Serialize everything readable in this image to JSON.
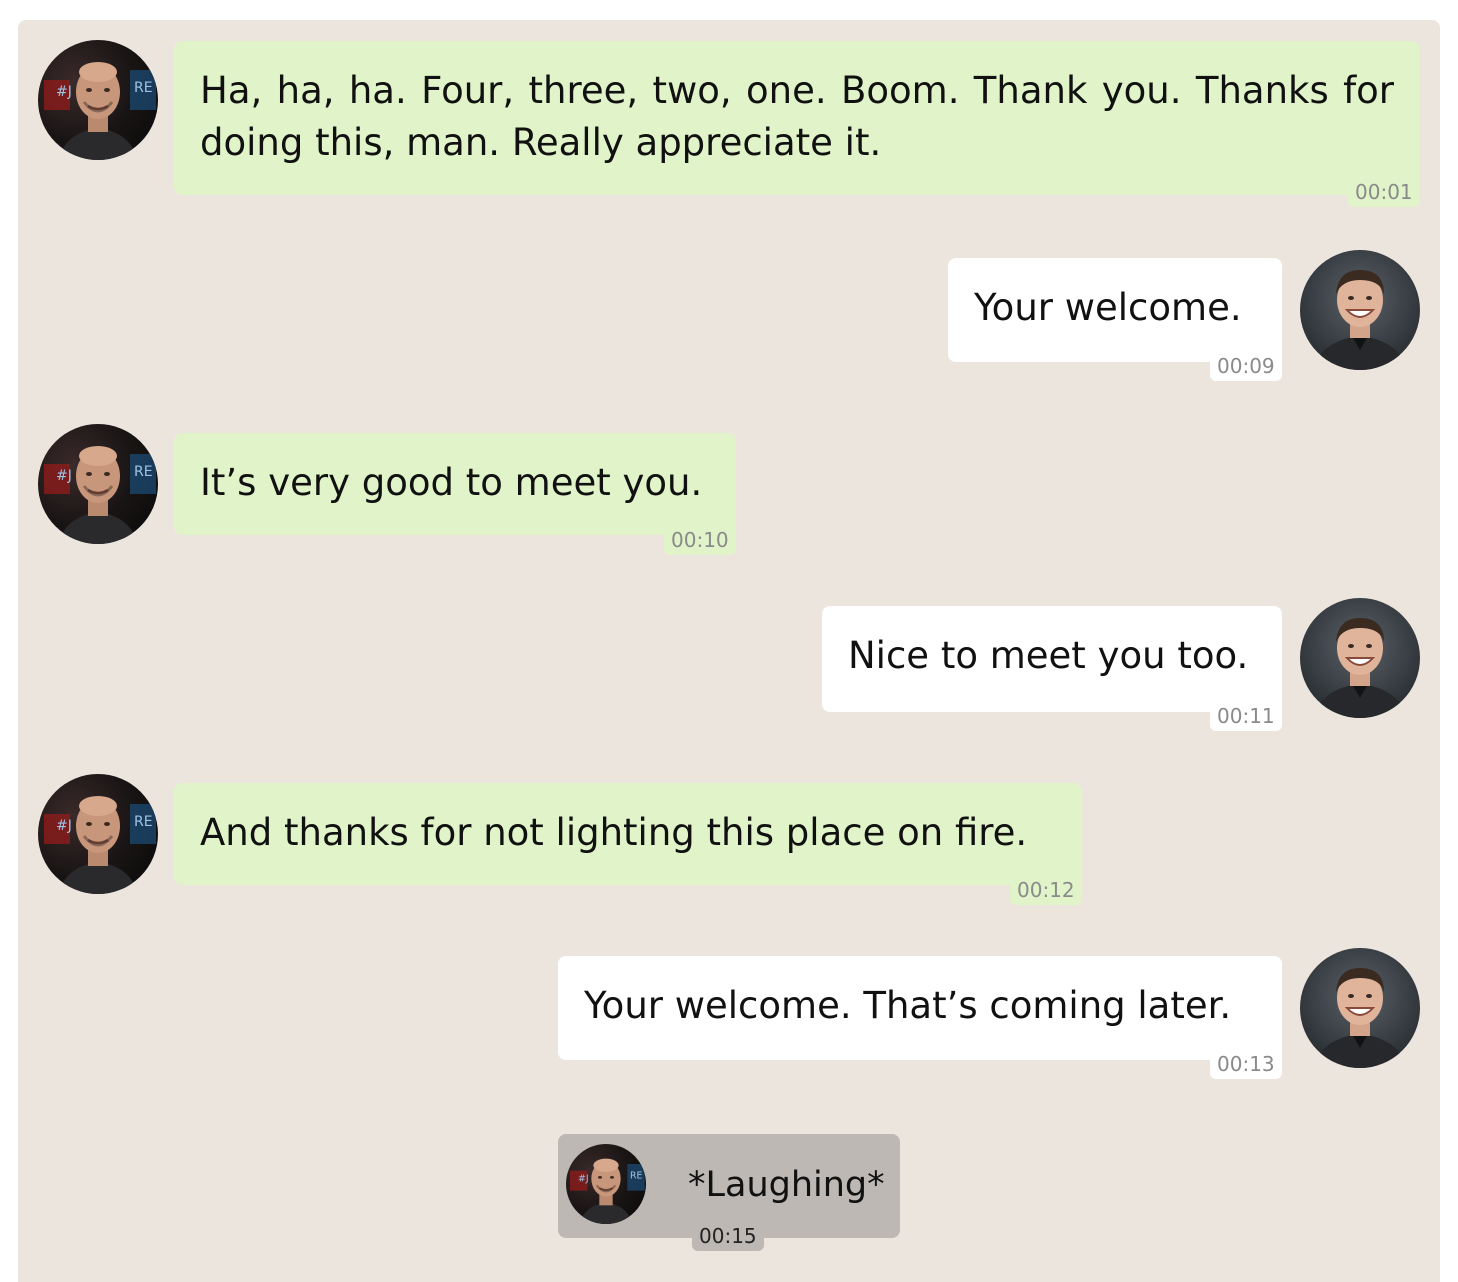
{
  "colors": {
    "chat_background": "#ece5de",
    "left_bubble": "#e1f4c9",
    "right_bubble": "#ffffff",
    "system_bubble": "#bdb8b3",
    "timestamp_text": "#8a8a8a"
  },
  "participants": {
    "host": {
      "avatar_icon": "host-avatar-photo",
      "side": "left"
    },
    "guest": {
      "avatar_icon": "guest-avatar-photo",
      "side": "right"
    }
  },
  "messages": [
    {
      "speaker": "host",
      "text": "Ha, ha, ha. Four, three, two, one. Boom. Thank you. Thanks for doing this, man. Really appreciate it.",
      "time": "00:01"
    },
    {
      "speaker": "guest",
      "text": "Your welcome.",
      "time": "00:09"
    },
    {
      "speaker": "host",
      "text": "It’s very good to meet you.",
      "time": "00:10"
    },
    {
      "speaker": "guest",
      "text": "Nice to meet you too.",
      "time": "00:11"
    },
    {
      "speaker": "host",
      "text": "And thanks for not lighting this place on fire.",
      "time": "00:12"
    },
    {
      "speaker": "guest",
      "text": "Your welcome. That’s coming later.",
      "time": "00:13"
    }
  ],
  "system_message": {
    "speaker": "host",
    "text": "*Laughing*",
    "time": "00:15"
  }
}
